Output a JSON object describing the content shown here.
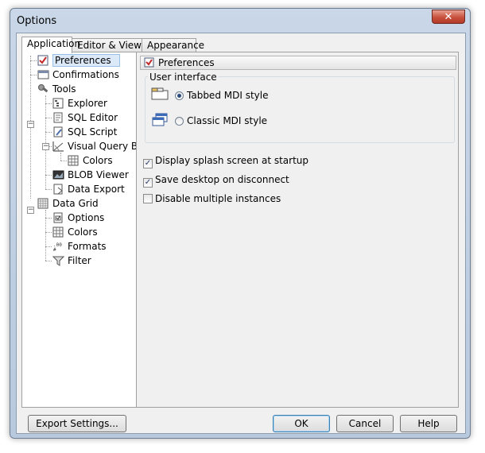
{
  "window": {
    "title": "Options",
    "close_glyph": "✕"
  },
  "tabs": [
    {
      "label": "Application",
      "active": true
    },
    {
      "label": "Editor & Viewers",
      "active": false
    },
    {
      "label": "Appearance",
      "active": false
    }
  ],
  "tree": {
    "items": [
      {
        "label": "Preferences",
        "icon": "checkbox-icon",
        "selected": true
      },
      {
        "label": "Confirmations",
        "icon": "message-icon"
      },
      {
        "label": "Tools",
        "icon": "tools-icon"
      },
      {
        "label": "Explorer",
        "icon": "explorer-icon"
      },
      {
        "label": "SQL Editor",
        "icon": "sql-editor-icon"
      },
      {
        "label": "SQL Script",
        "icon": "sql-script-icon"
      },
      {
        "label": "Visual Query Build",
        "icon": "query-builder-icon"
      },
      {
        "label": "Colors",
        "icon": "grid-colors-icon"
      },
      {
        "label": "BLOB Viewer",
        "icon": "blob-viewer-icon"
      },
      {
        "label": "Data Export",
        "icon": "data-export-icon"
      },
      {
        "label": "Data Grid",
        "icon": "data-grid-icon"
      },
      {
        "label": "Options",
        "icon": "options-icon"
      },
      {
        "label": "Colors",
        "icon": "colors-icon"
      },
      {
        "label": "Formats",
        "icon": "formats-icon"
      },
      {
        "label": "Filter",
        "icon": "filter-icon"
      }
    ]
  },
  "content": {
    "header": "Preferences",
    "group_title": "User interface",
    "radios": [
      {
        "label": "Tabbed MDI style",
        "checked": true
      },
      {
        "label": "Classic MDI style",
        "checked": false
      }
    ],
    "checkboxes": [
      {
        "label": "Display splash screen at startup",
        "checked": true
      },
      {
        "label": "Save desktop on disconnect",
        "checked": true
      },
      {
        "label": "Disable multiple instances",
        "checked": false
      }
    ]
  },
  "buttons": {
    "export": "Export Settings...",
    "ok": "OK",
    "cancel": "Cancel",
    "help": "Help"
  }
}
